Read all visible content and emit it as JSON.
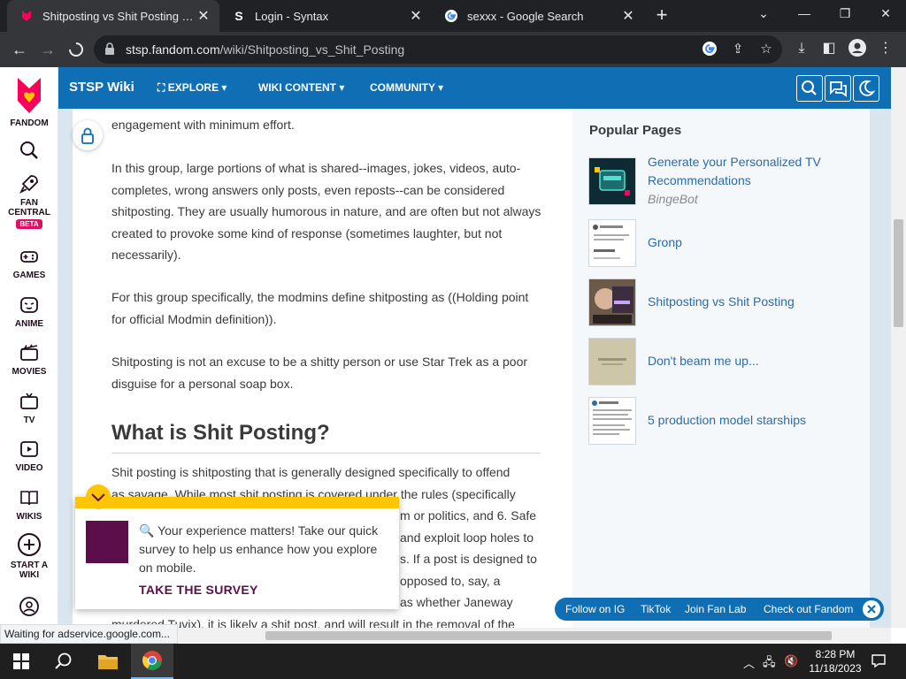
{
  "browser": {
    "tabs": [
      {
        "title": "Shitposting vs Shit Posting | STSP",
        "icon": "fandom-icon"
      },
      {
        "title": "Login - Syntax",
        "icon": "syntax-s-icon"
      },
      {
        "title": "sexxx - Google Search",
        "icon": "google-icon"
      }
    ],
    "url_host": "stsp.fandom.com",
    "url_path": "/wiki/Shitposting_vs_Shit_Posting",
    "status": "Waiting for adservice.google.com..."
  },
  "rail": {
    "brand": "FANDOM",
    "items": [
      {
        "label": "FAN CENTRAL",
        "badge": "BETA"
      },
      {
        "label": "GAMES"
      },
      {
        "label": "ANIME"
      },
      {
        "label": "MOVIES"
      },
      {
        "label": "TV"
      },
      {
        "label": "VIDEO"
      },
      {
        "label": "WIKIS"
      },
      {
        "label": "START A WIKI"
      }
    ]
  },
  "wiki": {
    "name": "STSP Wiki",
    "nav": [
      "EXPLORE",
      "WIKI CONTENT",
      "COMMUNITY"
    ]
  },
  "article": {
    "p0": "engagement with minimum effort.",
    "p1": "In this group, large portions of what is shared--images, jokes, videos, auto-completes, wrong answers only posts, even reposts--can be considered shitposting. They are usually humorous in nature, and are often but not always created to provoke some kind of response (sometimes laughter, but not necessarily).",
    "p2": "For this group specifically, the modmins define shitposting as ((Holding point for official Modmin definition)).",
    "p3": "Shitposting is not an excuse to be a shitty person or use Star Trek as a poor disguise for a personal soap box.",
    "heading": "What is Shit Posting?",
    "p4_line1": "Shit posting is shitposting that is generally designed specifically to offend",
    "p4_line2": "as savage. While most shit posting is covered under the rules (specifically",
    "p4_r3": "m or politics, and 6. Safe",
    "p4_r4": "and exploit loop holes to",
    "p4_r5": "s. If a post is designed to",
    "p4_r6": "opposed to, say, a",
    "p4_r7": "as whether Janeway",
    "p4_last": "murdered Tuvix), it is likely a shit post, and will result in the removal of the"
  },
  "popular": {
    "title": "Popular Pages",
    "items": [
      {
        "name": "Generate your Personalized TV Recommendations",
        "sub": "BingeBot"
      },
      {
        "name": "Gronp"
      },
      {
        "name": "Shitposting vs Shit Posting"
      },
      {
        "name": "Don't beam me up..."
      },
      {
        "name": "5 production model starships"
      }
    ]
  },
  "survey": {
    "message": "🔍 Your experience matters! Take our quick survey to help us enhance how you explore on mobile.",
    "cta": "TAKE THE SURVEY"
  },
  "social": [
    "Follow on IG",
    "TikTok",
    "Join Fan Lab",
    "Check out Fandom"
  ],
  "taskbar": {
    "time": "8:28 PM",
    "date": "11/18/2023"
  },
  "colors": {
    "fandom_blue": "#0f6eb4",
    "fandom_pink": "#e00f62",
    "survey_yellow": "#ffc500",
    "survey_purple": "#5c0e4a"
  }
}
